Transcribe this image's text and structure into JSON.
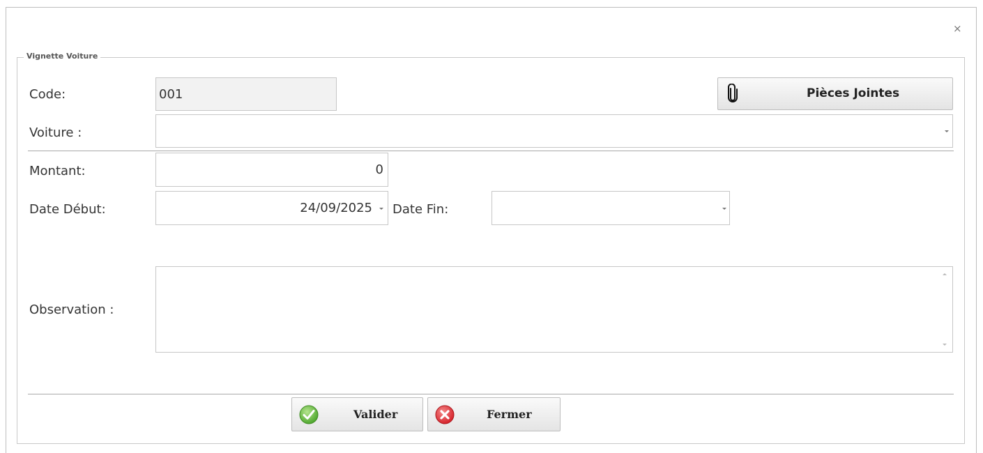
{
  "dialog": {
    "close_glyph": "×",
    "group_title": "Vignette Voiture"
  },
  "form": {
    "code_label": "Code:",
    "code_value": "001",
    "voiture_label": "Voiture :",
    "voiture_value": "",
    "montant_label": "Montant:",
    "montant_value": "0",
    "date_debut_label": "Date Début:",
    "date_debut_value": "24/09/2025",
    "date_fin_label": "Date Fin:",
    "date_fin_value": "",
    "observation_label": "Observation :",
    "observation_value": ""
  },
  "buttons": {
    "pieces_jointes": "Pièces Jointes",
    "valider": "Valider",
    "fermer": "Fermer"
  },
  "icons": {
    "attachment": "paperclip-icon",
    "valider": "checkmark-icon",
    "fermer": "close-circle-icon",
    "dropdown": "chevron-down-icon"
  },
  "colors": {
    "valider_icon": "#5cb33a",
    "fermer_icon": "#e0353d",
    "readonly_bg": "#f2f2f2"
  }
}
